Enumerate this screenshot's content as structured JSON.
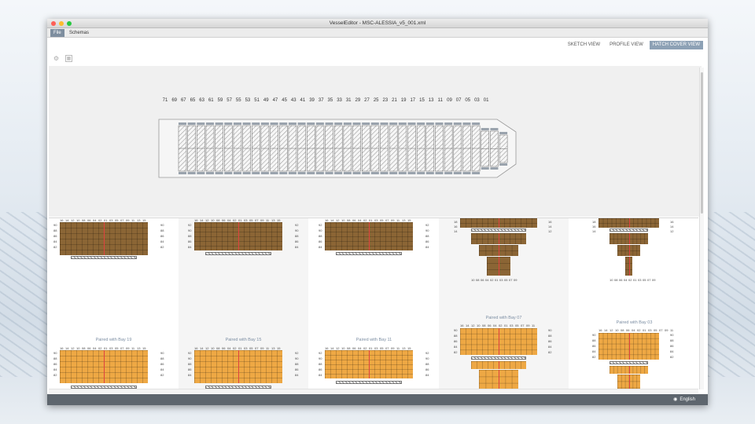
{
  "window": {
    "title": "VesselEditor - MSC-ALESSIA_v5_001.xml"
  },
  "menu": {
    "file": "File",
    "schemas": "Schemas"
  },
  "views": {
    "sketch": "SKETCH VIEW",
    "profile": "PROFILE VIEW",
    "hatch": "HATCH COVER VIEW",
    "active": "hatch"
  },
  "toolbar": {
    "settings_icon": "gear-icon",
    "grid_icon": "grid-icon"
  },
  "bay_numbers": [
    "71",
    "69",
    "67",
    "65",
    "63",
    "61",
    "59",
    "57",
    "55",
    "53",
    "51",
    "49",
    "47",
    "45",
    "43",
    "41",
    "39",
    "37",
    "35",
    "33",
    "31",
    "29",
    "27",
    "25",
    "23",
    "21",
    "19",
    "17",
    "15",
    "13",
    "11",
    "09",
    "07",
    "05",
    "03",
    "01"
  ],
  "row_numbers_wide": [
    "16",
    "14",
    "12",
    "10",
    "08",
    "06",
    "04",
    "02",
    "01",
    "03",
    "05",
    "07",
    "09",
    "11",
    "13",
    "15"
  ],
  "row_numbers_narrow": [
    "10",
    "08",
    "06",
    "04",
    "02",
    "01",
    "03",
    "05",
    "07",
    "09"
  ],
  "bays": {
    "upper_tiers_a": [
      "92",
      "90",
      "88",
      "86",
      "84",
      "82"
    ],
    "upper_tiers_b": [
      "92",
      "90",
      "88",
      "86",
      "84"
    ],
    "upper_tiers_c": [
      "90",
      "88",
      "86",
      "84",
      "82"
    ],
    "lower_tiers_a": [
      "18",
      "16",
      "14",
      "12",
      "10",
      "08",
      "06",
      "04",
      "02"
    ],
    "lower_tiers_b": [
      "16",
      "14",
      "12",
      "10",
      "08",
      "06",
      "04",
      "02"
    ],
    "paired": [
      "Paired with Bay 19",
      "Paired with Bay 15",
      "Paired with Bay 11",
      "Paired with Bay 07",
      "Paired with Bay 03"
    ]
  },
  "status": {
    "language": "English",
    "language_icon": "globe-icon"
  },
  "colors": {
    "hold": "#8b6535",
    "deck": "#eea844",
    "center_line": "#e0423f",
    "accent": "#8da1b5"
  }
}
